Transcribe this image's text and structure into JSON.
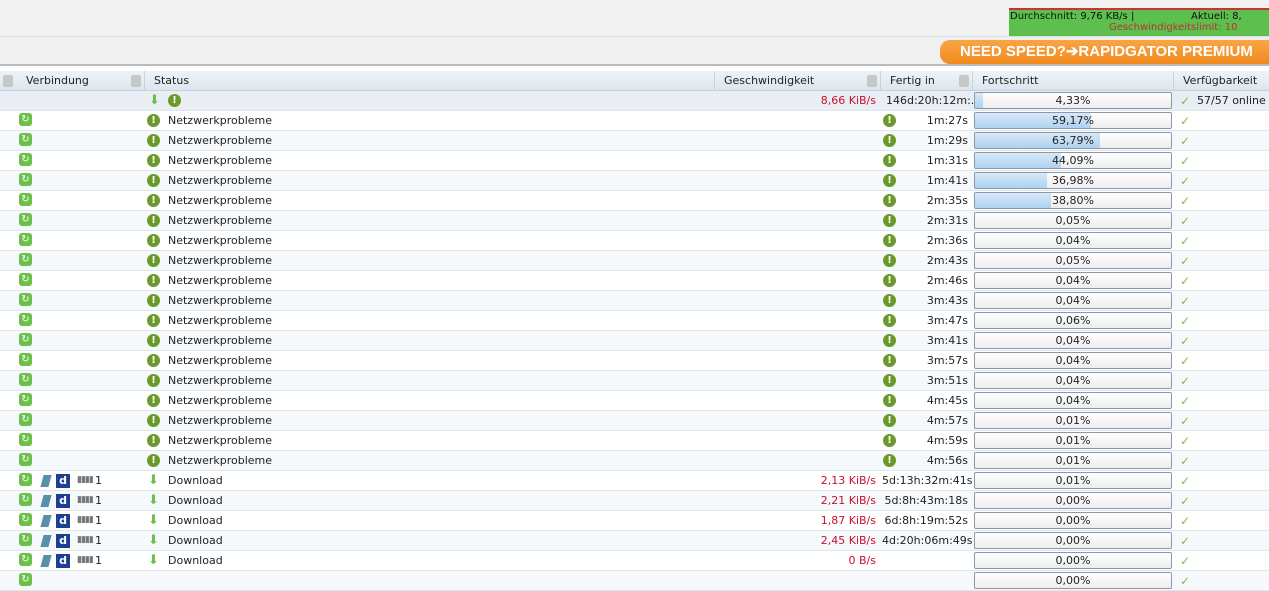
{
  "speed_panel": {
    "average": "Durchschnitt: 9,76 KB/s |",
    "current": "Aktuell: 8,",
    "limit": "Geschwindigkeitslimit: 10"
  },
  "banner": "NEED SPEED?➔RAPIDGATOR PREMIUM",
  "columns": [
    "Verbindung",
    "Status",
    "Geschwindigkeit",
    "Fertig in",
    "Fortschritt",
    "Verfügbarkeit"
  ],
  "package": {
    "speed": "8,66 KiB/s",
    "eta": "146d:20h:12m:...",
    "progress": "4,33%",
    "progress_value": 4.33,
    "availability": "57/57 online"
  },
  "rows": [
    {
      "status": "Netzwerkprobleme",
      "eta": "1m:27s",
      "progress": "59,17%",
      "pv": 59.17
    },
    {
      "status": "Netzwerkprobleme",
      "eta": "1m:29s",
      "progress": "63,79%",
      "pv": 63.79
    },
    {
      "status": "Netzwerkprobleme",
      "eta": "1m:31s",
      "progress": "44,09%",
      "pv": 44.09
    },
    {
      "status": "Netzwerkprobleme",
      "eta": "1m:41s",
      "progress": "36,98%",
      "pv": 36.98
    },
    {
      "status": "Netzwerkprobleme",
      "eta": "2m:35s",
      "progress": "38,80%",
      "pv": 38.8
    },
    {
      "status": "Netzwerkprobleme",
      "eta": "2m:31s",
      "progress": "0,05%",
      "pv": 0.05
    },
    {
      "status": "Netzwerkprobleme",
      "eta": "2m:36s",
      "progress": "0,04%",
      "pv": 0.04
    },
    {
      "status": "Netzwerkprobleme",
      "eta": "2m:43s",
      "progress": "0,05%",
      "pv": 0.05
    },
    {
      "status": "Netzwerkprobleme",
      "eta": "2m:46s",
      "progress": "0,04%",
      "pv": 0.04
    },
    {
      "status": "Netzwerkprobleme",
      "eta": "3m:43s",
      "progress": "0,04%",
      "pv": 0.04
    },
    {
      "status": "Netzwerkprobleme",
      "eta": "3m:47s",
      "progress": "0,06%",
      "pv": 0.06
    },
    {
      "status": "Netzwerkprobleme",
      "eta": "3m:41s",
      "progress": "0,04%",
      "pv": 0.04
    },
    {
      "status": "Netzwerkprobleme",
      "eta": "3m:57s",
      "progress": "0,04%",
      "pv": 0.04
    },
    {
      "status": "Netzwerkprobleme",
      "eta": "3m:51s",
      "progress": "0,04%",
      "pv": 0.04
    },
    {
      "status": "Netzwerkprobleme",
      "eta": "4m:45s",
      "progress": "0,04%",
      "pv": 0.04
    },
    {
      "status": "Netzwerkprobleme",
      "eta": "4m:57s",
      "progress": "0,01%",
      "pv": 0.01
    },
    {
      "status": "Netzwerkprobleme",
      "eta": "4m:59s",
      "progress": "0,01%",
      "pv": 0.01
    },
    {
      "status": "Netzwerkprobleme",
      "eta": "4m:56s",
      "progress": "0,01%",
      "pv": 0.01
    },
    {
      "status": "Download",
      "conn": "1",
      "speed": "2,13 KiB/s",
      "eta": "5d:13h:32m:41s",
      "progress": "0,01%",
      "pv": 0.01
    },
    {
      "status": "Download",
      "conn": "1",
      "speed": "2,21 KiB/s",
      "eta": "5d:8h:43m:18s",
      "progress": "0,00%",
      "pv": 0
    },
    {
      "status": "Download",
      "conn": "1",
      "speed": "1,87 KiB/s",
      "eta": "6d:8h:19m:52s",
      "progress": "0,00%",
      "pv": 0
    },
    {
      "status": "Download",
      "conn": "1",
      "speed": "2,45 KiB/s",
      "eta": "4d:20h:06m:49s",
      "progress": "0,00%",
      "pv": 0
    },
    {
      "status": "Download",
      "conn": "1",
      "speed": "0 B/s",
      "eta": "",
      "progress": "0,00%",
      "pv": 0
    },
    {
      "status": "",
      "eta": "",
      "progress": "0,00%",
      "pv": 0
    }
  ]
}
